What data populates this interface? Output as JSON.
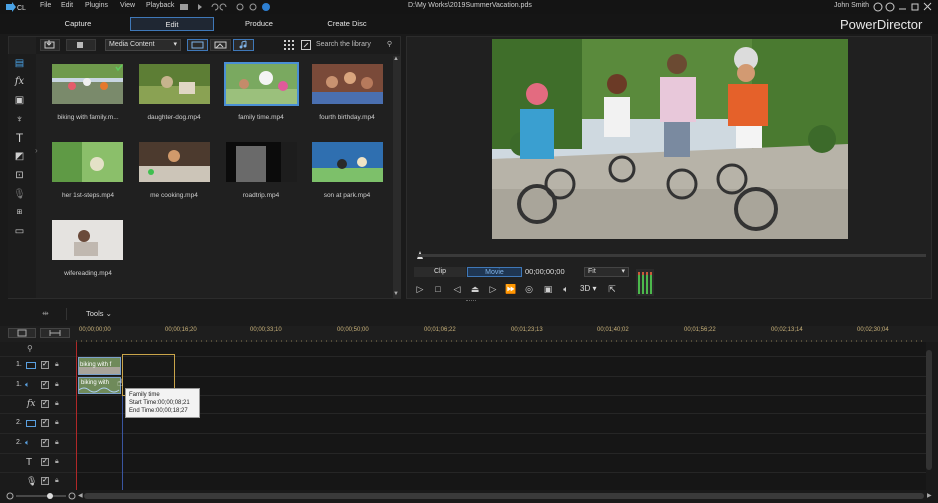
{
  "menu": {
    "items": [
      "File",
      "Edit",
      "Plugins",
      "View",
      "Playback"
    ]
  },
  "window": {
    "path": "D:\\My Works\\2019SummerVacation.pds",
    "user": "John Smith",
    "brand": "PowerDirector"
  },
  "modes": {
    "capture": "Capture",
    "edit": "Edit",
    "produce": "Produce",
    "create_disc": "Create Disc"
  },
  "library": {
    "dropdown": "Media Content",
    "search_placeholder": "Search the library",
    "items": [
      {
        "label": "biking with family.m...",
        "colors": [
          "#6f9a4c",
          "#c9d6e2"
        ]
      },
      {
        "label": "daughter-dog.mp4",
        "colors": [
          "#5d7e35",
          "#c7b48e"
        ]
      },
      {
        "label": "family time.mp4",
        "colors": [
          "#7aa960",
          "#e8e3d6"
        ]
      },
      {
        "label": "fourth birthday.mp4",
        "colors": [
          "#7a4a39",
          "#c99270"
        ]
      },
      {
        "label": "her 1st-steps.mp4",
        "colors": [
          "#8bbf6a",
          "#e4e1c7"
        ]
      },
      {
        "label": "me cooking.mp4",
        "colors": [
          "#4c3a2e",
          "#d19a6b"
        ]
      },
      {
        "label": "roadtrip.mp4",
        "colors": [
          "#0b0b0b",
          "#6a6a6a"
        ]
      },
      {
        "label": "son at park.mp4",
        "colors": [
          "#2f6fb0",
          "#7dc06a"
        ]
      },
      {
        "label": "wifereading.mp4",
        "colors": [
          "#e5e3e0",
          "#c0b8b0"
        ]
      }
    ]
  },
  "preview": {
    "tab_clip": "Clip",
    "tab_movie": "Movie",
    "timecode": "00;00;00;00",
    "fit": "Fit",
    "mode_3d": "3D"
  },
  "toolbar": {
    "tools": "Tools"
  },
  "timeline": {
    "ruler": [
      "00;00;00;00",
      "00;00;16;20",
      "00;00;33;10",
      "00;00;50;00",
      "00;01;06;22",
      "00;01;23;13",
      "00;01;40;02",
      "00;01;56;22",
      "00;02;13;14",
      "00;02;30;04"
    ],
    "tracks": [
      "1.",
      "1.",
      "2.",
      "2."
    ],
    "clip_label_video": "biking with f",
    "clip_label_audio": "biking with",
    "tooltip": {
      "title": "Family time",
      "start": "Start Time:00;00;08;21",
      "end": "End Time:00;00;18;27"
    }
  },
  "colors": {
    "accent": "#3f78b8",
    "ruler_text": "#c9b27a"
  }
}
